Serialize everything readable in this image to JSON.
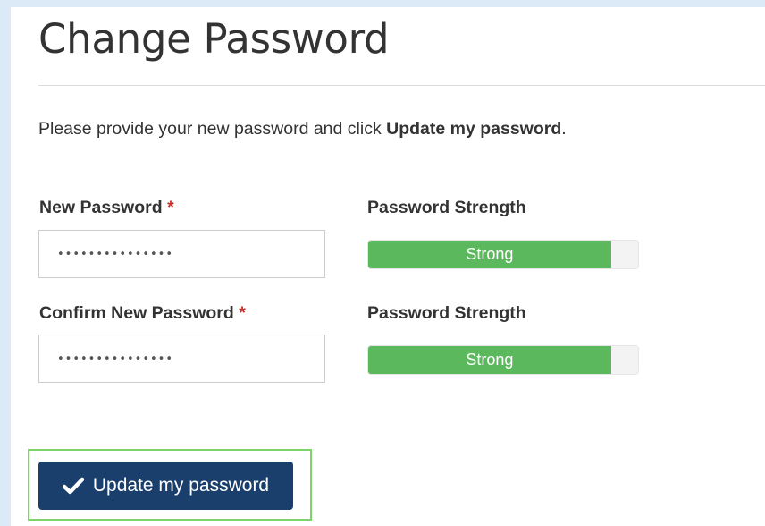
{
  "page": {
    "title": "Change Password",
    "instructions_prefix": "Please provide your new password and click ",
    "instructions_bold": "Update my password",
    "instructions_suffix": "."
  },
  "fields": [
    {
      "label": "New Password",
      "required_marker": "*",
      "value": "•••••••••••••••",
      "strength_label": "Password Strength",
      "strength_text": "Strong",
      "strength_fraction": 0.9
    },
    {
      "label": "Confirm New Password",
      "required_marker": "*",
      "value": "•••••••••••••••",
      "strength_label": "Password Strength",
      "strength_text": "Strong",
      "strength_fraction": 0.9
    }
  ],
  "submit": {
    "label": "Update my password",
    "icon": "checkmark-icon"
  },
  "colors": {
    "primary_button": "#1b3f6d",
    "strength_fill": "#5cb85c",
    "required": "#c9302c",
    "focus_outline": "#7ed36b"
  }
}
